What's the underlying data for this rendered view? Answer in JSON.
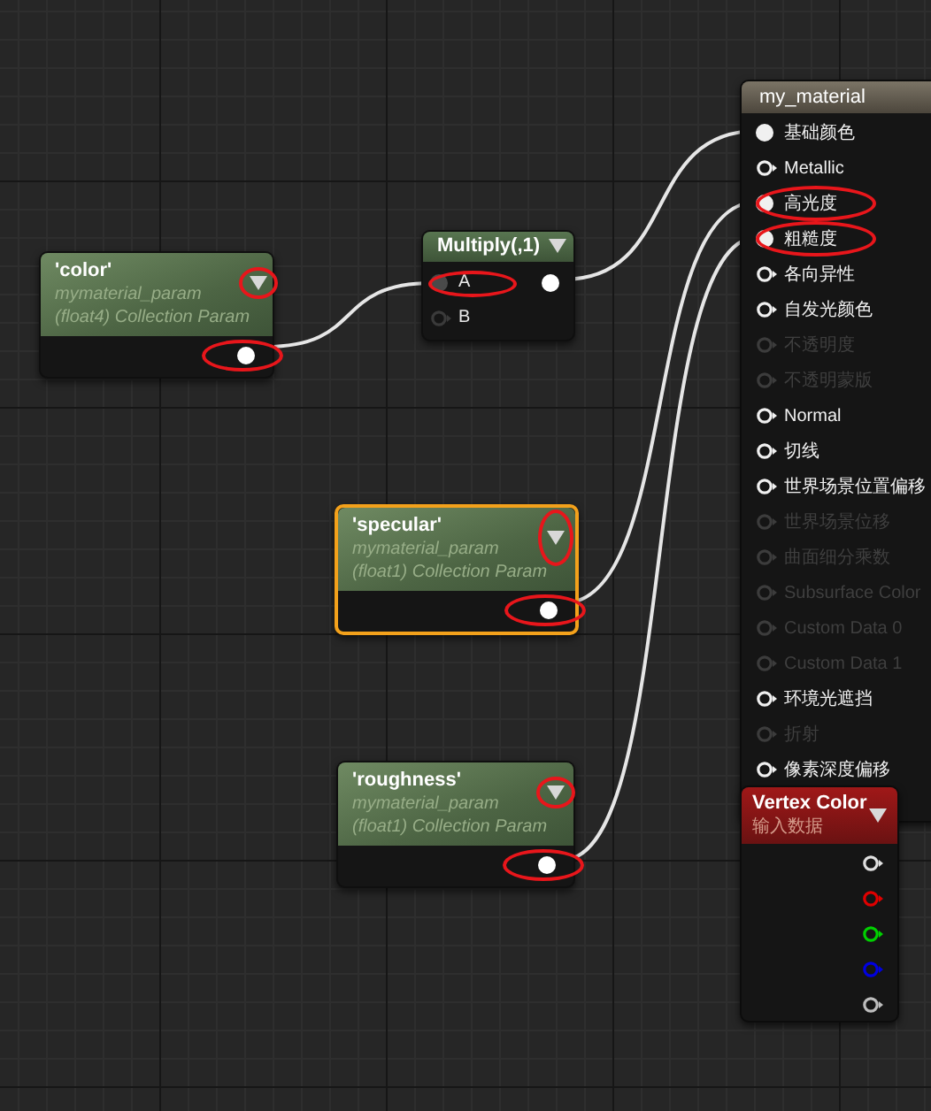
{
  "graph": {
    "nodes": [
      {
        "kind": "param",
        "title": "'color'",
        "subtitle": [
          "mymaterial_param",
          "(float4) Collection Param"
        ],
        "selected": false,
        "arrow_circled": true,
        "output": {
          "connected": true,
          "circled": true
        }
      },
      {
        "kind": "math",
        "title": "Multiply(,1)",
        "inputs": [
          {
            "label": "A",
            "connected": true,
            "circled": true
          },
          {
            "label": "B",
            "connected": false,
            "circled": false
          }
        ],
        "output": {
          "connected": true
        }
      },
      {
        "kind": "param",
        "title": "'specular'",
        "subtitle": [
          "mymaterial_param",
          "(float1) Collection Param"
        ],
        "selected": true,
        "arrow_circled": true,
        "output": {
          "connected": true,
          "circled": true
        }
      },
      {
        "kind": "param",
        "title": "'roughness'",
        "subtitle": [
          "mymaterial_param",
          "(float1) Collection Param"
        ],
        "selected": false,
        "arrow_circled": true,
        "output": {
          "connected": true,
          "circled": true
        }
      },
      {
        "kind": "material",
        "title": "my_material",
        "inputs": [
          {
            "label": "基础颜色",
            "connected": true,
            "disabled": false,
            "circled": false
          },
          {
            "label": "Metallic",
            "connected": false,
            "disabled": false,
            "circled": false
          },
          {
            "label": "高光度",
            "connected": true,
            "disabled": false,
            "circled": true
          },
          {
            "label": "粗糙度",
            "connected": true,
            "disabled": false,
            "circled": true
          },
          {
            "label": "各向异性",
            "connected": false,
            "disabled": false,
            "circled": false
          },
          {
            "label": "自发光颜色",
            "connected": false,
            "disabled": false,
            "circled": false
          },
          {
            "label": "不透明度",
            "connected": false,
            "disabled": true,
            "circled": false
          },
          {
            "label": "不透明蒙版",
            "connected": false,
            "disabled": true,
            "circled": false
          },
          {
            "label": "Normal",
            "connected": false,
            "disabled": false,
            "circled": false
          },
          {
            "label": "切线",
            "connected": false,
            "disabled": false,
            "circled": false
          },
          {
            "label": "世界场景位置偏移",
            "connected": false,
            "disabled": false,
            "circled": false
          },
          {
            "label": "世界场景位移",
            "connected": false,
            "disabled": true,
            "circled": false
          },
          {
            "label": "曲面细分乘数",
            "connected": false,
            "disabled": true,
            "circled": false
          },
          {
            "label": "Subsurface Color",
            "connected": false,
            "disabled": true,
            "circled": false
          },
          {
            "label": "Custom Data 0",
            "connected": false,
            "disabled": true,
            "circled": false
          },
          {
            "label": "Custom Data 1",
            "connected": false,
            "disabled": true,
            "circled": false
          },
          {
            "label": "环境光遮挡",
            "connected": false,
            "disabled": false,
            "circled": false
          },
          {
            "label": "折射",
            "connected": false,
            "disabled": true,
            "circled": false
          },
          {
            "label": "像素深度偏移",
            "connected": false,
            "disabled": false,
            "circled": false
          }
        ]
      },
      {
        "kind": "vertex",
        "title": "Vertex Color",
        "subtitle": [
          "输入数据"
        ],
        "outputs": [
          {
            "color": "#e0e0e0"
          },
          {
            "color": "#e00000"
          },
          {
            "color": "#00d000"
          },
          {
            "color": "#0000e0"
          },
          {
            "color": "#bdbdbd"
          }
        ]
      }
    ]
  }
}
